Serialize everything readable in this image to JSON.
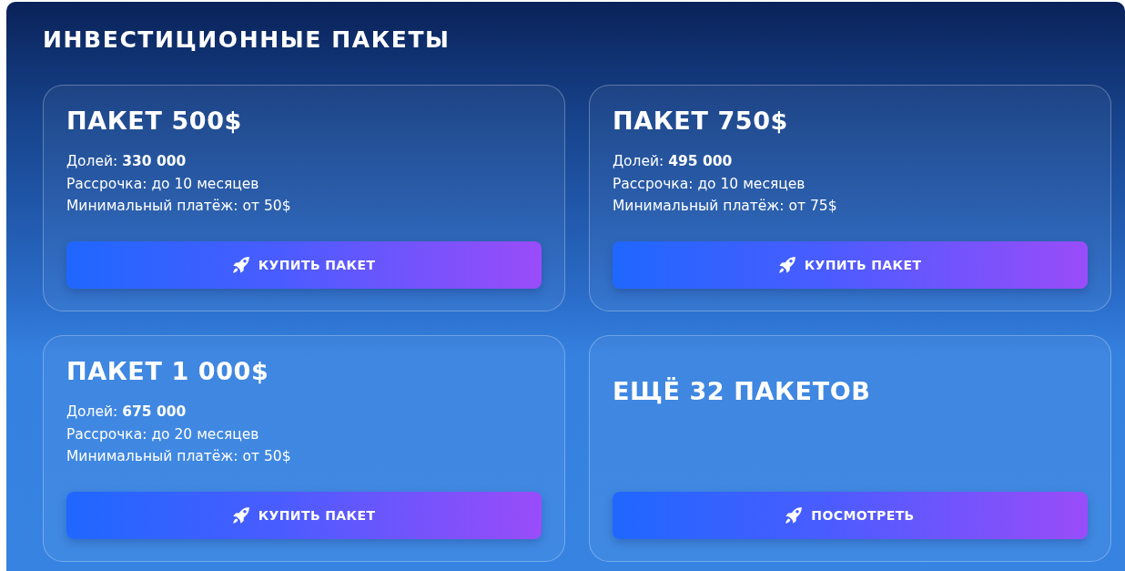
{
  "section": {
    "title": "ИНВЕСТИЦИОННЫЕ ПАКЕТЫ"
  },
  "packages": [
    {
      "kind": "package",
      "title": "ПАКЕТ 500$",
      "details": [
        "Долей: **330 000**",
        "Рассрочка: до 10 месяцев",
        "Минимальный платёж: от 50$"
      ],
      "button": "КУПИТЬ ПАКЕТ"
    },
    {
      "kind": "package",
      "title": "ПАКЕТ 750$",
      "details": [
        "Долей: **495 000**",
        "Рассрочка: до 10 месяцев",
        "Минимальный платёж: от 75$"
      ],
      "button": "КУПИТЬ ПАКЕТ"
    },
    {
      "kind": "package",
      "title": "ПАКЕТ 1 000$",
      "details": [
        "Долей: **675 000**",
        "Рассрочка: до 20 месяцев",
        "Минимальный платёж: от 50$"
      ],
      "button": "КУПИТЬ ПАКЕТ"
    },
    {
      "kind": "more",
      "title": "ЕЩЁ 32 ПАКЕТОВ",
      "button": "ПОСМОТРЕТЬ"
    }
  ]
}
